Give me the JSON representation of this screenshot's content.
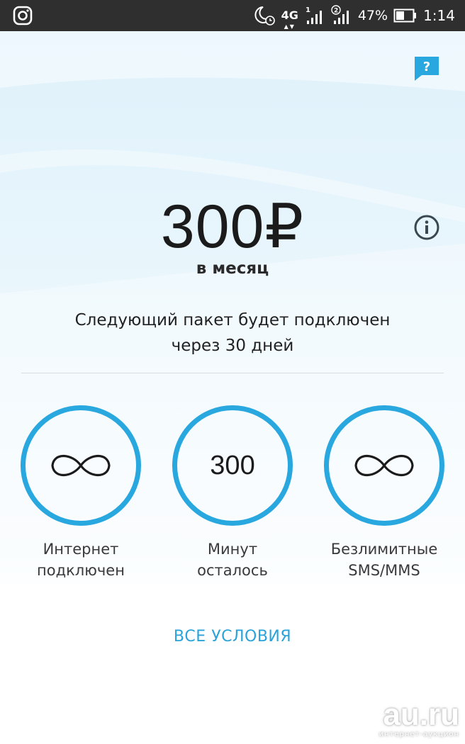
{
  "status_bar": {
    "network": "4G",
    "sim1": "1",
    "sim2": "2",
    "battery": "47%",
    "time": "1:14",
    "icons": [
      "instagram-icon",
      "do-not-disturb-moon-icon",
      "signal-icon",
      "battery-icon"
    ]
  },
  "tariff": {
    "price": "300₽",
    "period": "в месяц",
    "next_package_line1": "Следующий пакет будет подключен",
    "next_package_line2": "через 30 дней"
  },
  "stats": [
    {
      "value": "∞",
      "label_line1": "Интернет",
      "label_line2": "подключен"
    },
    {
      "value": "300",
      "label_line1": "Минут",
      "label_line2": "осталось"
    },
    {
      "value": "∞",
      "label_line1": "Безлимитные",
      "label_line2": "SMS/MMS"
    }
  ],
  "all_terms_label": "ВСЕ УСЛОВИЯ",
  "watermark": {
    "site": "au.ru",
    "caption": "интернет-аукцион"
  },
  "colors": {
    "accent": "#29a7df",
    "status_bar": "#2f2f2f",
    "text": "#222222"
  }
}
